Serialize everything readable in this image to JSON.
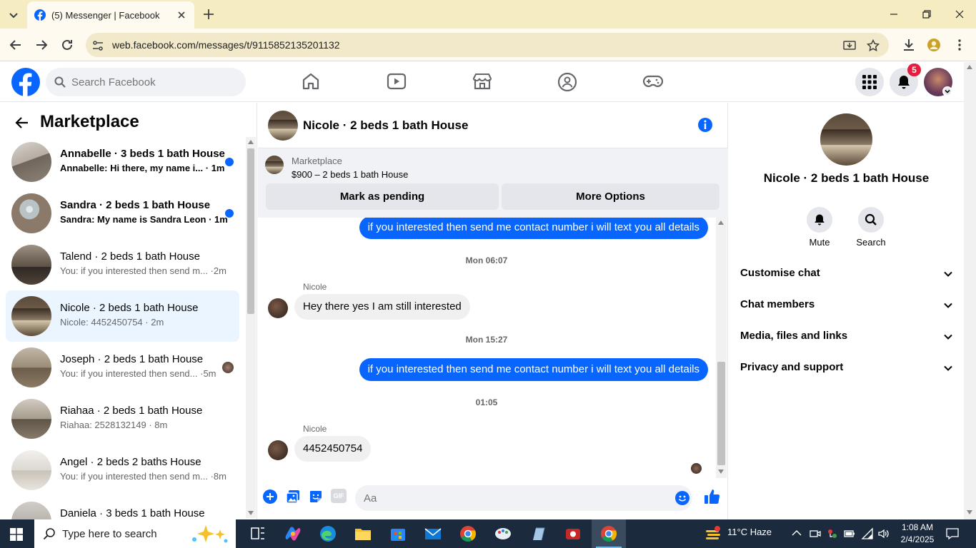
{
  "browser": {
    "tab_title": "(5) Messenger | Facebook",
    "url": "web.facebook.com/messages/t/9115852135201132"
  },
  "fb": {
    "search_placeholder": "Search Facebook",
    "notification_count": "5"
  },
  "left": {
    "title": "Marketplace",
    "conversations": [
      {
        "name": "Annabelle · 3 beds 1 bath House",
        "preview": "Annabelle: Hi there, my name i...",
        "time": "1m",
        "unread": true
      },
      {
        "name": "Sandra · 2 beds 1 bath House",
        "preview": "Sandra: My name is Sandra Leon",
        "time": "1m",
        "unread": true
      },
      {
        "name": "Talend · 2 beds 1 bath House",
        "preview": "You: if you interested then send m...",
        "time": "2m",
        "unread": false
      },
      {
        "name": "Nicole · 2 beds 1 bath House",
        "preview": "Nicole: 4452450754",
        "time": "2m",
        "unread": false,
        "selected": true
      },
      {
        "name": "Joseph · 2 beds 1 bath House",
        "preview": "You: if you interested then send...",
        "time": "5m",
        "unread": false
      },
      {
        "name": "Riahaa · 2 beds 1 bath House",
        "preview": "Riahaa: 2528132149",
        "time": "8m",
        "unread": false
      },
      {
        "name": "Angel · 2 beds 2 baths House",
        "preview": "You: if you interested then send m...",
        "time": "8m",
        "unread": false
      },
      {
        "name": "Daniela · 3 beds 1 bath House",
        "preview": "",
        "time": "",
        "unread": false
      }
    ]
  },
  "chat": {
    "title": "Nicole · 2 beds 1 bath House",
    "marketplace_label": "Marketplace",
    "listing": "$900 – 2 beds 1 bath House",
    "mark_pending": "Mark as pending",
    "more_options": "More Options",
    "messages": {
      "out1": "if you interested then send me contact number i will text you all details",
      "ts1": "Mon 06:07",
      "sender1": "Nicole",
      "in1": "Hey there yes I am still interested",
      "ts2": "Mon 15:27",
      "out2": "if you interested then send me contact number i will text you all details",
      "ts3": "01:05",
      "sender2": "Nicole",
      "in2": "4452450754"
    },
    "composer_placeholder": "Aa",
    "gif_label": "GIF"
  },
  "right": {
    "name": "Nicole · 2 beds 1 bath House",
    "mute": "Mute",
    "search": "Search",
    "sections": [
      "Customise chat",
      "Chat members",
      "Media, files and links",
      "Privacy and support"
    ]
  },
  "taskbar": {
    "search_text": "Type here to search",
    "weather": "11°C  Haze",
    "time": "1:08 AM",
    "date": "2/4/2025"
  },
  "colors": {
    "accent": "#0866ff",
    "chrome_bg": "#f5ecc2",
    "taskbar_bg": "#1c2a3d"
  }
}
